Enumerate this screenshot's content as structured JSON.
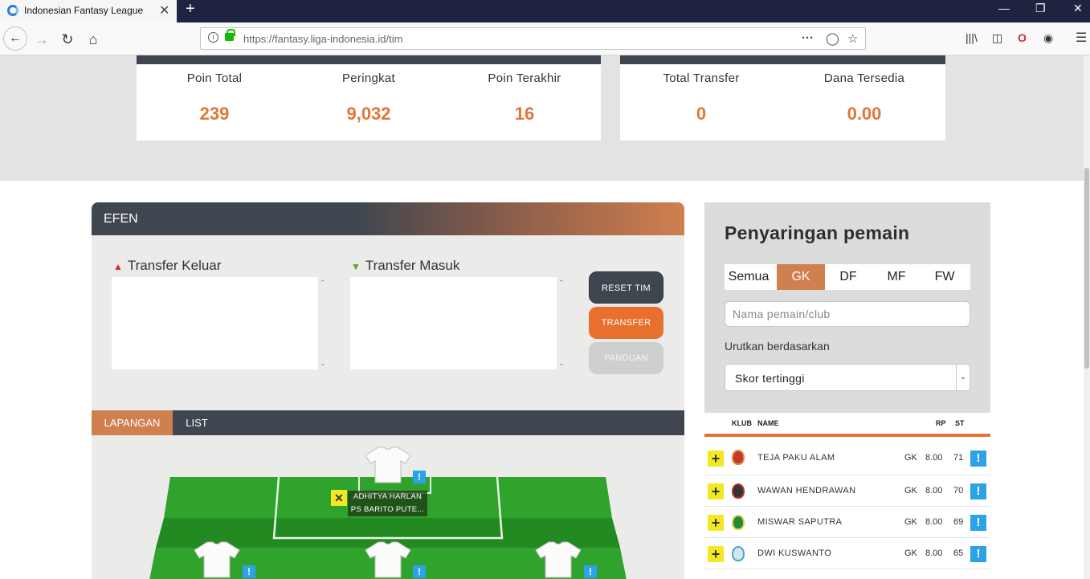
{
  "browser": {
    "tab_title": "Indonesian Fantasy League",
    "tab_close": "✕",
    "new_tab": "+",
    "url": "https://fantasy.liga-indonesia.id/tim",
    "win_minimize": "—",
    "win_restore": "❐",
    "win_close": "✕"
  },
  "stats_left": [
    {
      "label": "Poin Total",
      "value": "239"
    },
    {
      "label": "Peringkat",
      "value": "9,032"
    },
    {
      "label": "Poin Terakhir",
      "value": "16"
    }
  ],
  "stats_right": [
    {
      "label": "Total Transfer",
      "value": "0"
    },
    {
      "label": "Dana Tersedia",
      "value": "0.00"
    }
  ],
  "team_panel": {
    "team_name": "EFEN",
    "transfer_out_label": "Transfer Keluar",
    "transfer_in_label": "Transfer Masuk",
    "reset_button": "RESET TIM",
    "transfer_button": "TRANSFER",
    "guide_button": "PANDUAN",
    "view_tabs": [
      "LAPANGAN",
      "LIST"
    ],
    "goalkeeper": {
      "name": "ADHITYA HARLAN",
      "club": "PS BARITO PUTE..."
    }
  },
  "filter": {
    "title": "Penyaringan pemain",
    "positions": [
      "Semua",
      "GK",
      "DF",
      "MF",
      "FW"
    ],
    "active_position": "GK",
    "search_placeholder": "Nama pemain/club",
    "sort_label": "Urutkan berdasarkan",
    "sort_value": "Skor tertinggi"
  },
  "player_table": {
    "headers": {
      "club": "KLUB",
      "name": "NAME",
      "price": "RP",
      "st": "ST"
    },
    "rows": [
      {
        "name": "TEJA PAKU ALAM",
        "pos": "GK",
        "price": "8.00",
        "st": "71",
        "club_color": "#c0392b"
      },
      {
        "name": "WAWAN HENDRAWAN",
        "pos": "GK",
        "price": "8.00",
        "st": "70",
        "club_color": "#333333"
      },
      {
        "name": "MISWAR SAPUTRA",
        "pos": "GK",
        "price": "8.00",
        "st": "69",
        "club_color": "#1e8a3a"
      },
      {
        "name": "DWI KUSWANTO",
        "pos": "GK",
        "price": "8.00",
        "st": "65",
        "club_color": "#4aa3c7"
      }
    ]
  },
  "colors": {
    "accent_orange": "#e2763a",
    "dark_slate": "#40464f",
    "info_blue": "#2ca3e8",
    "add_yellow": "#f3e923",
    "pitch_green": "#2e9a2a"
  }
}
